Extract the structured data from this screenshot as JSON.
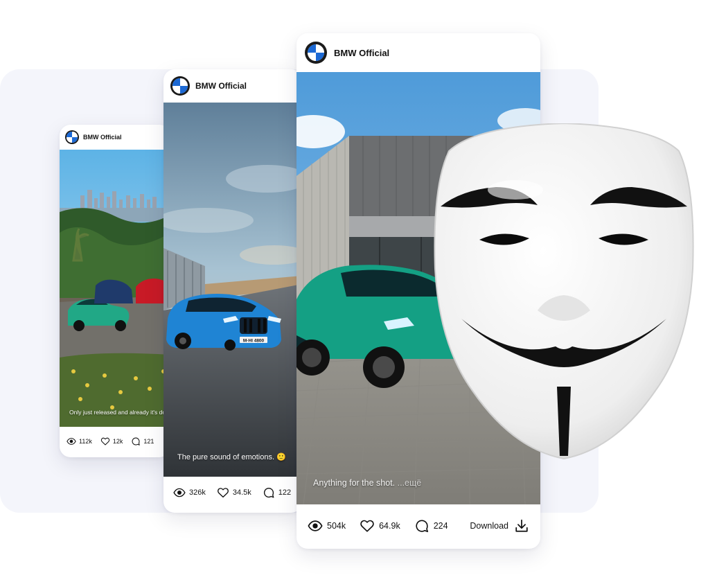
{
  "posts": [
    {
      "author": "BMW Official",
      "caption": "Only just released and already it's dor",
      "views": "112k",
      "likes": "12k",
      "comments": "121"
    },
    {
      "author": "BMW Official",
      "caption": "The pure sound of emotions. 🙂",
      "views": "326k",
      "likes": "34.5k",
      "comments": "122",
      "plate": "M·HI 4800"
    },
    {
      "author": "BMW Official",
      "caption": "Anything for the shot.",
      "caption_more": "...ещё",
      "views": "504k",
      "likes": "64.9k",
      "comments": "224",
      "download_label": "Download"
    }
  ],
  "icons": {
    "views": "eye-icon",
    "likes": "heart-icon",
    "comments": "comment-icon",
    "download": "download-icon",
    "avatar": "bmw-logo"
  },
  "colors": {
    "backdrop": "#f4f5fb",
    "bmw_blue": "#1c69d4",
    "card_bg": "#ffffff",
    "text": "#111111"
  }
}
